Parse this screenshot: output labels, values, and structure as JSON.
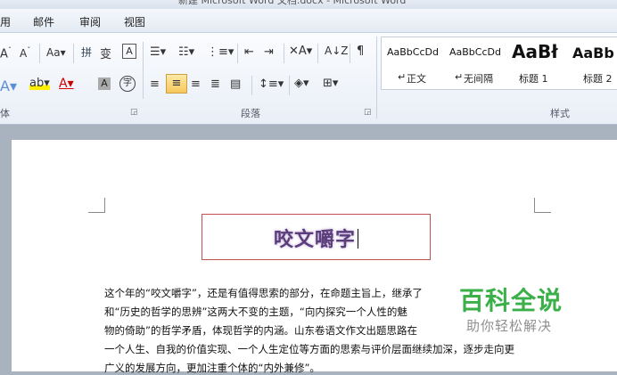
{
  "window": {
    "title": "新建 Microsoft Word 文档.docx - Microsoft Word"
  },
  "tabs": [
    "用",
    "邮件",
    "审阅",
    "视图"
  ],
  "ribbon": {
    "font_row1": [
      "A",
      "A",
      "Aa",
      "wén",
      "A"
    ],
    "paragraph_group_label": "段落",
    "font_group_label": "体",
    "styles_group_label": "样式",
    "styles": [
      {
        "preview": "AaBbCcDd",
        "name": "正文",
        "marker": "↵"
      },
      {
        "preview": "AaBbCcDd",
        "name": "无间隔",
        "marker": "↵"
      },
      {
        "preview": "AaBł",
        "name": "标题 1"
      },
      {
        "preview": "AaBb",
        "name": "标题 2"
      }
    ]
  },
  "document": {
    "title": "咬文嚼字",
    "lines": [
      "这个年的“咬文嚼字”，还是有值得思索的部分，在命题主旨上，继承了",
      "和“历史的哲学的思辨”这两大不变的主题，“向内探究一个人性的魅",
      "物的倚助”的哲学矛盾，体现哲学的内涵。山东卷语文作文出题思路在",
      "一个人生、自我的价值实现、一个人生定位等方面的思索与评价层面继续加深，逐步走向更",
      "广义的发展方向，更加注重个体的“内外兼修”。"
    ]
  },
  "watermark": {
    "main": "百科全说",
    "sub": "助你轻松解决"
  },
  "colors": {
    "watermark_green": "#3bb049",
    "title_box_border": "#c0504d",
    "title_color": "#5a3d7a"
  }
}
